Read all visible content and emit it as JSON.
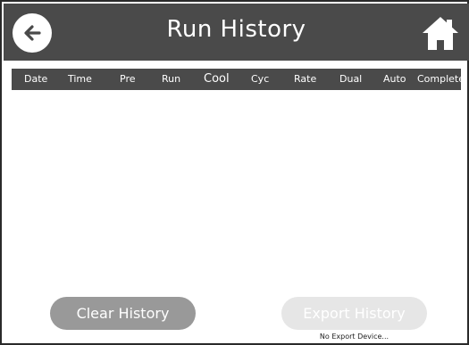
{
  "header": {
    "title": "Run History",
    "background": "#4a4a4a"
  },
  "table": {
    "columns": [
      "Date",
      "Time",
      "Pre",
      "Run",
      "Cool",
      "Cyc",
      "Rate",
      "Dual",
      "Auto",
      "Complete"
    ],
    "rows": []
  },
  "actions": {
    "clear_label": "Clear History",
    "export_label": "Export History",
    "export_status": "No Export Device..."
  },
  "icons": {
    "back": "back-arrow-icon",
    "home": "home-icon"
  }
}
